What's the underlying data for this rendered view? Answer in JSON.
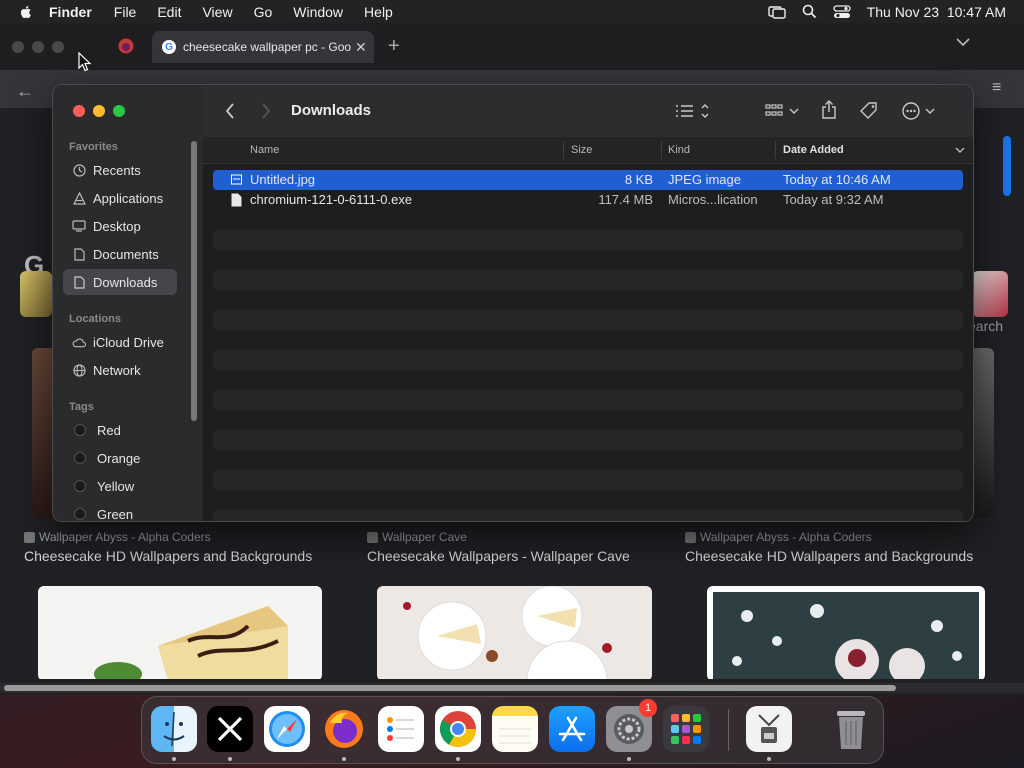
{
  "menubar": {
    "app_name": "Finder",
    "items": [
      "File",
      "Edit",
      "View",
      "Go",
      "Window",
      "Help"
    ],
    "clock": "Thu Nov 23  10:47 AM",
    "status_icons": [
      "screen-mirroring-icon",
      "spotlight-icon",
      "control-center-icon"
    ]
  },
  "browser": {
    "tab_title": "cheesecake wallpaper pc - Goo",
    "search_partial": "earch",
    "logo_partial": "G",
    "results": [
      {
        "source": "Wallpaper Abyss - Alpha Coders",
        "title": "Cheesecake HD Wallpapers and Backgrounds"
      },
      {
        "source": "Wallpaper Cave",
        "title": "Cheesecake Wallpapers - Wallpaper Cave"
      },
      {
        "source": "Wallpaper Abyss - Alpha Coders",
        "title": "Cheesecake HD Wallpapers and Backgrounds"
      }
    ]
  },
  "finder": {
    "title": "Downloads",
    "sidebar": {
      "favorites_header": "Favorites",
      "favorites": [
        {
          "label": "Recents",
          "icon": "clock-icon"
        },
        {
          "label": "Applications",
          "icon": "applications-icon"
        },
        {
          "label": "Desktop",
          "icon": "desktop-icon"
        },
        {
          "label": "Documents",
          "icon": "document-icon"
        },
        {
          "label": "Downloads",
          "icon": "downloads-icon",
          "selected": true
        }
      ],
      "locations_header": "Locations",
      "locations": [
        {
          "label": "iCloud Drive",
          "icon": "cloud-icon"
        },
        {
          "label": "Network",
          "icon": "network-icon"
        }
      ],
      "tags_header": "Tags",
      "tags": [
        {
          "label": "Red"
        },
        {
          "label": "Orange"
        },
        {
          "label": "Yellow"
        },
        {
          "label": "Green"
        }
      ]
    },
    "columns": {
      "name": "Name",
      "size": "Size",
      "kind": "Kind",
      "date": "Date Added"
    },
    "files": [
      {
        "name": "Untitled.jpg",
        "size": "8 KB",
        "kind": "JPEG image",
        "date": "Today at 10:46 AM",
        "selected": true
      },
      {
        "name": "chromium-121-0-6111-0.exe",
        "size": "117.4 MB",
        "kind": "Micros...lication",
        "date": "Today at 9:32 AM",
        "selected": false
      }
    ]
  },
  "dock": {
    "apps": [
      {
        "name": "Finder",
        "icon": "finder-icon",
        "running": true
      },
      {
        "name": "X",
        "icon": "x-icon",
        "running": true
      },
      {
        "name": "Safari",
        "icon": "safari-icon",
        "running": false
      },
      {
        "name": "Firefox",
        "icon": "firefox-icon",
        "running": true
      },
      {
        "name": "Reminders",
        "icon": "reminders-icon",
        "running": false
      },
      {
        "name": "Chrome",
        "icon": "chrome-icon",
        "running": true
      },
      {
        "name": "Notes",
        "icon": "notes-icon",
        "running": false
      },
      {
        "name": "App Store",
        "icon": "app-store-icon",
        "running": false
      },
      {
        "name": "System Settings",
        "icon": "settings-icon",
        "running": true,
        "badge": "1"
      },
      {
        "name": "Launchpad",
        "icon": "launchpad-icon",
        "running": false
      },
      {
        "name": "Archive Utility",
        "icon": "archive-icon",
        "running": true
      },
      {
        "name": "Trash",
        "icon": "trash-icon",
        "running": false
      }
    ]
  }
}
